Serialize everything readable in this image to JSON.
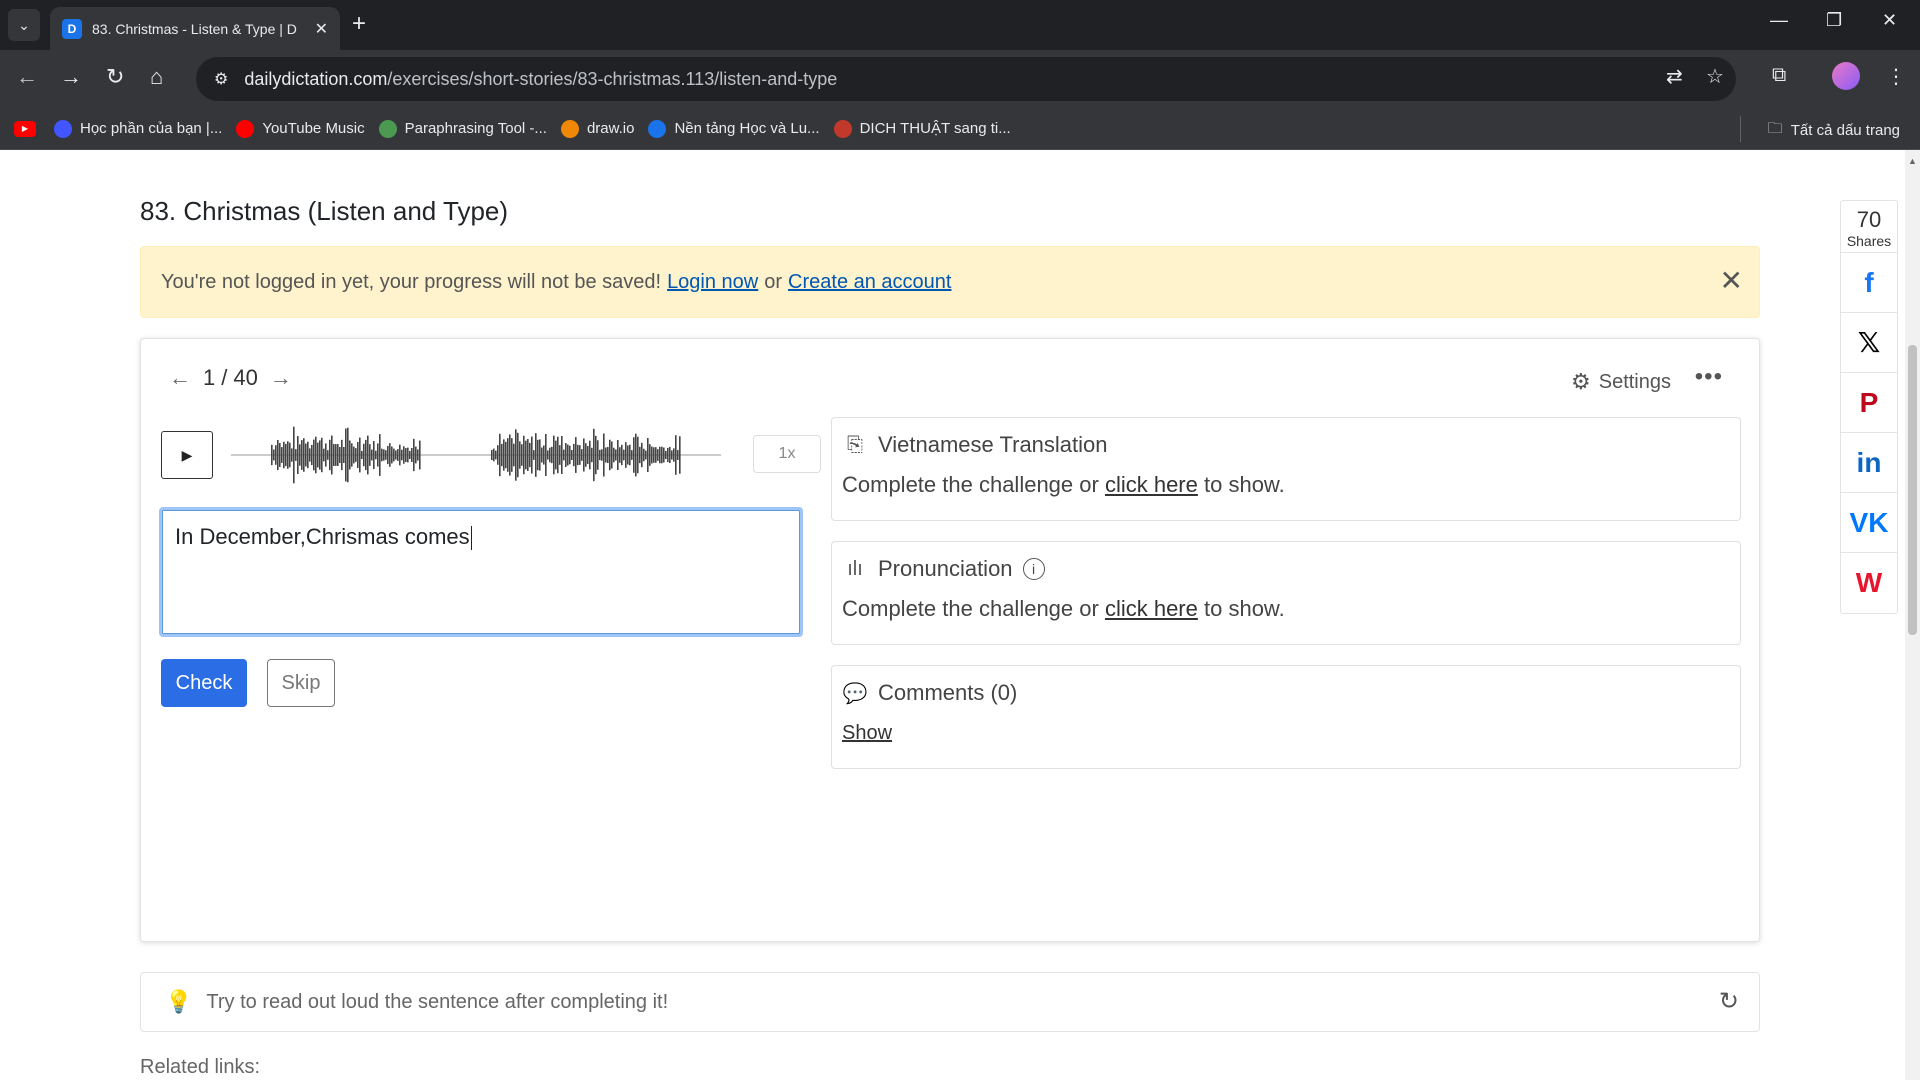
{
  "browser": {
    "tab_title": "83. Christmas - Listen & Type | D",
    "tab_favicon": "D",
    "url_domain": "dailydictation.com",
    "url_path": "/exercises/short-stories/83-christmas.113/listen-and-type",
    "bookmarks": [
      {
        "label": "",
        "icon": "youtube-icon",
        "color": "#ff0000"
      },
      {
        "label": "Học phần của bạn |...",
        "icon": "quizlet-icon",
        "color": "#4255ff"
      },
      {
        "label": "YouTube Music",
        "icon": "youtube-music-icon",
        "color": "#ff0000"
      },
      {
        "label": "Paraphrasing Tool -...",
        "icon": "quillbot-icon",
        "color": "#4c9a52"
      },
      {
        "label": "draw.io",
        "icon": "drawio-icon",
        "color": "#f08705"
      },
      {
        "label": "Nền tảng Học và Lu...",
        "icon": "platform-icon",
        "color": "#1a73e8"
      },
      {
        "label": "DICH THUẬT sang ti...",
        "icon": "translate-icon",
        "color": "#c0392b"
      }
    ],
    "all_bookmarks": "Tất cả dấu trang"
  },
  "page": {
    "title": "83. Christmas (Listen and Type)",
    "alert": {
      "text": "You're not logged in yet, your progress will not be saved!",
      "login": "Login now",
      "or": "or",
      "create": "Create an account"
    },
    "exercise": {
      "current": "1",
      "separator": "/",
      "total": "40",
      "settings": "Settings",
      "speed": "1x",
      "answer": "In December,Chrismas comes",
      "check": "Check",
      "skip": "Skip"
    },
    "translation": {
      "title": "Vietnamese Translation",
      "text_before": "Complete the challenge or",
      "link": "click here",
      "text_after": "to show."
    },
    "pronunciation": {
      "title": "Pronunciation",
      "text_before": "Complete the challenge or",
      "link": "click here",
      "text_after": "to show."
    },
    "comments": {
      "title": "Comments (0)",
      "show": "Show"
    },
    "tip": "Try to read out loud the sentence after completing it!",
    "related": "Related links:"
  },
  "share": {
    "count": "70",
    "label": "Shares",
    "buttons": [
      {
        "icon": "facebook-icon",
        "glyph": "f",
        "color": "#1877f2"
      },
      {
        "icon": "x-twitter-icon",
        "glyph": "𝕏",
        "color": "#000000"
      },
      {
        "icon": "pinterest-icon",
        "glyph": "P",
        "color": "#bd081c"
      },
      {
        "icon": "linkedin-icon",
        "glyph": "in",
        "color": "#0a66c2"
      },
      {
        "icon": "vk-icon",
        "glyph": "VK",
        "color": "#0077ff"
      },
      {
        "icon": "weibo-icon",
        "glyph": "W",
        "color": "#e6162d"
      }
    ]
  }
}
